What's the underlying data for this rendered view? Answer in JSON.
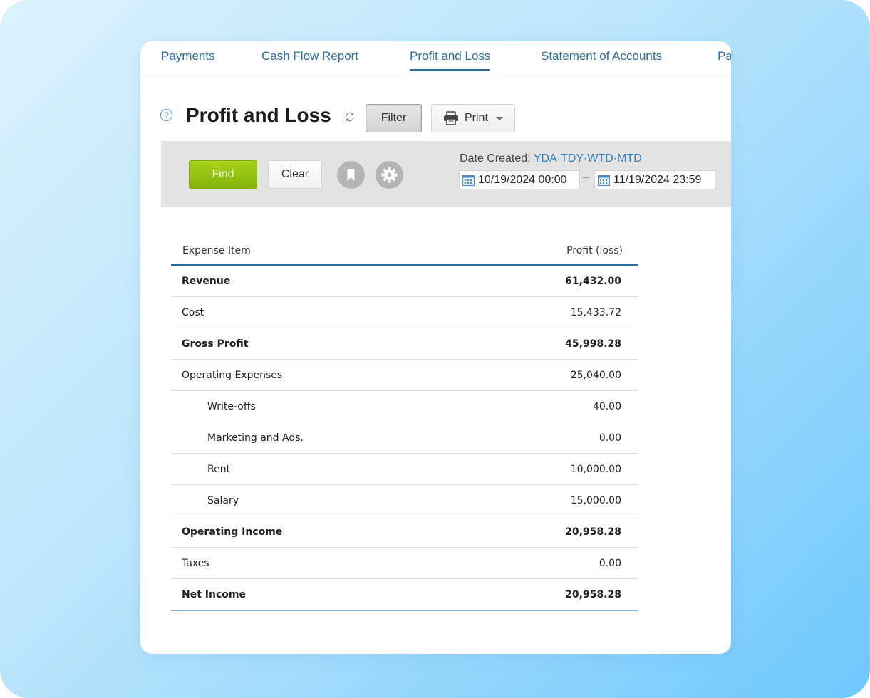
{
  "tabs": [
    {
      "label": "Payments",
      "active": false
    },
    {
      "label": "Cash Flow Report",
      "active": false
    },
    {
      "label": "Profit and Loss",
      "active": true
    },
    {
      "label": "Statement of Accounts",
      "active": false
    },
    {
      "label": "Pa",
      "active": false
    }
  ],
  "header": {
    "title": "Profit and Loss",
    "help_icon": "question-circle-icon",
    "refresh_icon": "refresh-icon",
    "filter_label": "Filter",
    "print_label": "Print"
  },
  "filter_bar": {
    "find_label": "Find",
    "clear_label": "Clear",
    "bookmark_icon": "bookmark-icon",
    "settings_icon": "gear-icon",
    "date_label": "Date Created:",
    "presets": [
      "YDA",
      "TDY",
      "WTD",
      "MTD"
    ],
    "preset_separator": "·",
    "date_from": "10/19/2024 00:00",
    "date_separator": "–",
    "date_to": "11/19/2024 23:59",
    "colors": {
      "find": "#94c213",
      "link": "#2f7fb8"
    }
  },
  "table": {
    "columns": [
      "Expense Item",
      "Profit (loss)"
    ],
    "rows": [
      {
        "item": "Revenue",
        "value": "61,432.00",
        "bold": true,
        "indent": false
      },
      {
        "item": "Cost",
        "value": "15,433.72",
        "bold": false,
        "indent": false
      },
      {
        "item": "Gross Profit",
        "value": "45,998.28",
        "bold": true,
        "indent": false
      },
      {
        "item": "Operating Expenses",
        "value": "25,040.00",
        "bold": false,
        "indent": false
      },
      {
        "item": "Write-offs",
        "value": "40.00",
        "bold": false,
        "indent": true
      },
      {
        "item": "Marketing and Ads.",
        "value": "0.00",
        "bold": false,
        "indent": true
      },
      {
        "item": "Rent",
        "value": "10,000.00",
        "bold": false,
        "indent": true
      },
      {
        "item": "Salary",
        "value": "15,000.00",
        "bold": false,
        "indent": true
      },
      {
        "item": "Operating Income",
        "value": "20,958.28",
        "bold": true,
        "indent": false
      },
      {
        "item": "Taxes",
        "value": "0.00",
        "bold": false,
        "indent": false
      },
      {
        "item": "Net Income",
        "value": "20,958.28",
        "bold": true,
        "indent": false
      }
    ]
  }
}
